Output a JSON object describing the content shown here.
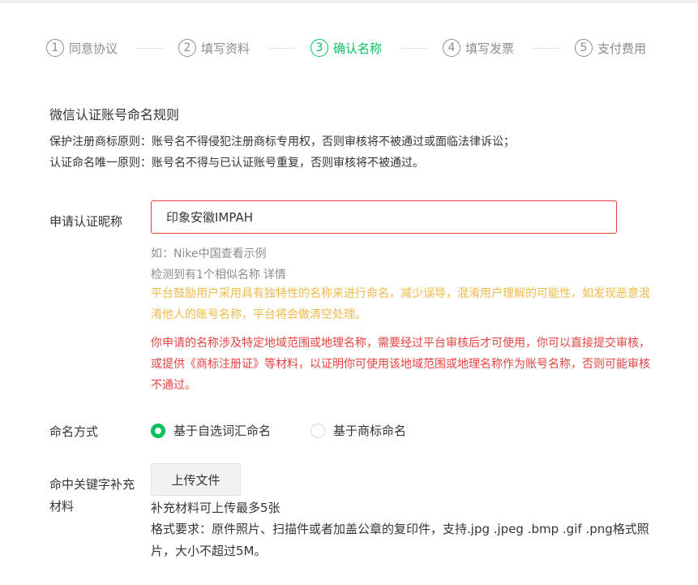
{
  "steps": [
    {
      "num": "1",
      "label": "同意协议"
    },
    {
      "num": "2",
      "label": "填写资料"
    },
    {
      "num": "3",
      "label": "确认名称"
    },
    {
      "num": "4",
      "label": "填写发票"
    },
    {
      "num": "5",
      "label": "支付费用"
    }
  ],
  "active_step": "3",
  "colors": {
    "accent": "#07c160",
    "error": "#e64340",
    "warning": "#f2b94b",
    "muted": "#8d8d8d"
  },
  "rules": {
    "title": "微信认证账号命名规则",
    "line1": "保护注册商标原则：账号名不得侵犯注册商标专用权，否则审核将不被通过或面临法律诉讼；",
    "line2": "认证命名唯一原则：账号名不得与已认证账号重复，否则审核将不被通过。"
  },
  "name_field": {
    "label": "申请认证昵称",
    "value": "印象安徽IMPAH",
    "example": "如：Nike中国查看示例",
    "similar": "检测到有1个相似名称",
    "detail_link": "详情",
    "warning_yellow": "平台鼓励用户采用具有独特性的名称来进行命名，减少误导，混淆用户理解的可能性，如发现恶意混淆他人的账号名称，平台将会做清空处理。",
    "warning_red": "你申请的名称涉及特定地域范围或地理名称，需要经过平台审核后才可使用，你可以直接提交审核，或提供《商标注册证》等材料，以证明你可使用该地域范围或地理名称作为账号名称，否则可能审核不通过。"
  },
  "naming_method": {
    "label": "命名方式",
    "options": [
      {
        "label": "基于自选词汇命名",
        "checked": true
      },
      {
        "label": "基于商标命名",
        "checked": false
      }
    ]
  },
  "keyword_material": {
    "label": "命中关键字补充材料",
    "upload_label": "上传文件",
    "limit": "补充材料可上传最多5张",
    "format": "格式要求：原件照片、扫描件或者加盖公章的复印件，支持.jpg .jpeg .bmp .gif .png格式照片，大小不超过5M。"
  }
}
